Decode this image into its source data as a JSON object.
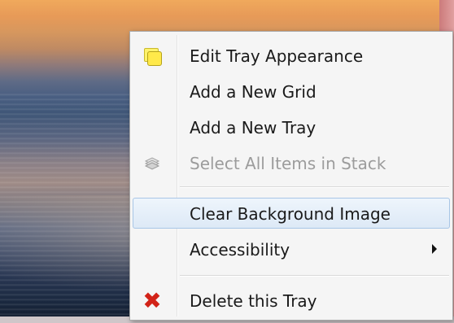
{
  "context_menu": {
    "items": [
      {
        "label": "Edit Tray Appearance",
        "icon": "sticky-notes-icon",
        "enabled": true,
        "highlighted": false
      },
      {
        "label": "Add a New Grid",
        "icon": "",
        "enabled": true,
        "highlighted": false
      },
      {
        "label": "Add a New Tray",
        "icon": "",
        "enabled": true,
        "highlighted": false
      },
      {
        "label": "Select All Items in Stack",
        "icon": "stack-icon",
        "enabled": false,
        "highlighted": false
      },
      {
        "label": "Clear Background Image",
        "icon": "",
        "enabled": true,
        "highlighted": true
      },
      {
        "label": "Accessibility",
        "icon": "",
        "enabled": true,
        "highlighted": false,
        "has_submenu": true
      },
      {
        "label": "Delete this Tray",
        "icon": "delete-x-icon",
        "enabled": true,
        "highlighted": false
      }
    ],
    "delete_glyph": "✖",
    "colors": {
      "menu_background": "#f5f5f5",
      "highlight_border": "#a8c6e6",
      "disabled_text": "#9c9c9c",
      "delete_icon": "#d22318",
      "sticky_note": "#ffe94a"
    }
  }
}
